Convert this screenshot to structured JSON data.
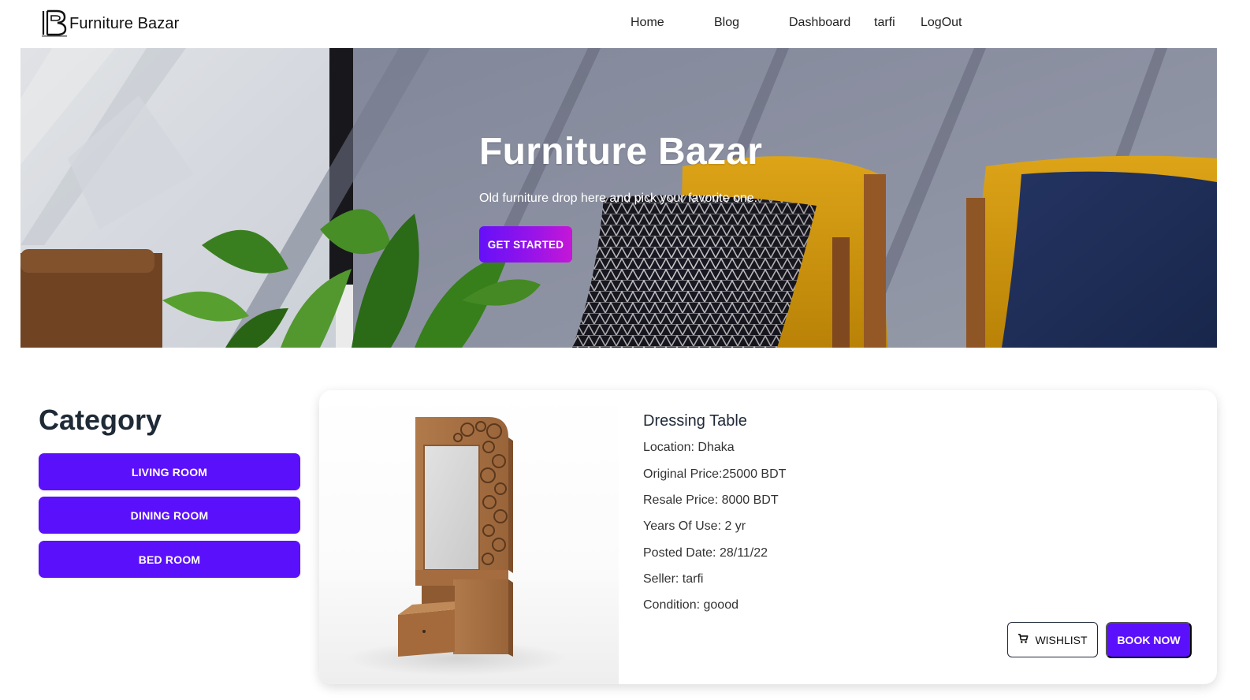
{
  "brand": {
    "name": "Furniture Bazar",
    "logo_icon": "fb-logo-icon"
  },
  "nav": {
    "links": [
      {
        "label": "Home"
      },
      {
        "label": "Blog"
      },
      {
        "label": "Dashboard"
      },
      {
        "label": "tarfi"
      },
      {
        "label": "LogOut"
      }
    ]
  },
  "hero": {
    "title": "Furniture Bazar",
    "subtitle": "Old furniture drop here and pick your favorite one.",
    "cta_label": "GET STARTED"
  },
  "category": {
    "title": "Category",
    "items": [
      {
        "label": "LIVING ROOM"
      },
      {
        "label": "DINING ROOM"
      },
      {
        "label": "BED ROOM"
      }
    ]
  },
  "product": {
    "name": "Dressing Table",
    "location": "Location: Dhaka",
    "original_price": "Original Price:25000 BDT",
    "resale_price": "Resale Price: 8000 BDT",
    "years_of_use": "Years Of Use: 2 yr",
    "posted_date": "Posted Date: 28/11/22",
    "seller": "Seller: tarfi",
    "condition": "Condition: goood",
    "wishlist_label": "WISHLIST",
    "wishlist_icon": "cart-icon",
    "book_label": "BOOK NOW"
  },
  "colors": {
    "primary": "#5b10fc",
    "gradient_start": "#6510f8",
    "gradient_end": "#c617d6",
    "text_dark": "#1f2937"
  }
}
